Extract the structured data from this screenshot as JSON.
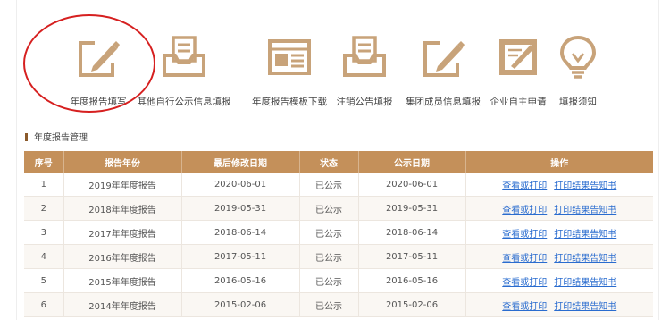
{
  "colors": {
    "icon": "#c8a37a",
    "header_bg": "#c4905a",
    "annotation": "#d62020",
    "link": "#2a6ccf"
  },
  "nav": [
    {
      "label": "年度报告填写",
      "icon": "edit-doc-icon"
    },
    {
      "label": "其他自行公示信息填报",
      "icon": "tray-doc-icon"
    },
    {
      "label": "年度报告模板下载",
      "icon": "template-icon"
    },
    {
      "label": "注销公告填报",
      "icon": "tray-doc-icon"
    },
    {
      "label": "集团成员信息填报",
      "icon": "edit-doc-icon"
    },
    {
      "label": "企业自主申请",
      "icon": "signed-doc-icon"
    },
    {
      "label": "填报须知",
      "icon": "lightbulb-icon"
    }
  ],
  "section": {
    "title": "年度报告管理"
  },
  "table": {
    "headers": [
      "序号",
      "报告年份",
      "最后修改日期",
      "状态",
      "公示日期",
      "操作"
    ],
    "rows": [
      {
        "no": "1",
        "year": "2019年年度报告",
        "modified": "2020-06-01",
        "status": "已公示",
        "published": "2020-06-01"
      },
      {
        "no": "2",
        "year": "2018年年度报告",
        "modified": "2019-05-31",
        "status": "已公示",
        "published": "2019-05-31"
      },
      {
        "no": "3",
        "year": "2017年年度报告",
        "modified": "2018-06-14",
        "status": "已公示",
        "published": "2018-06-14"
      },
      {
        "no": "4",
        "year": "2016年年度报告",
        "modified": "2017-05-11",
        "status": "已公示",
        "published": "2017-05-11"
      },
      {
        "no": "5",
        "year": "2015年年度报告",
        "modified": "2016-05-16",
        "status": "已公示",
        "published": "2016-05-16"
      },
      {
        "no": "6",
        "year": "2014年年度报告",
        "modified": "2015-02-06",
        "status": "已公示",
        "published": "2015-02-06"
      }
    ],
    "actions": {
      "view": "查看或打印",
      "print_notice": "打印结果告知书"
    }
  }
}
